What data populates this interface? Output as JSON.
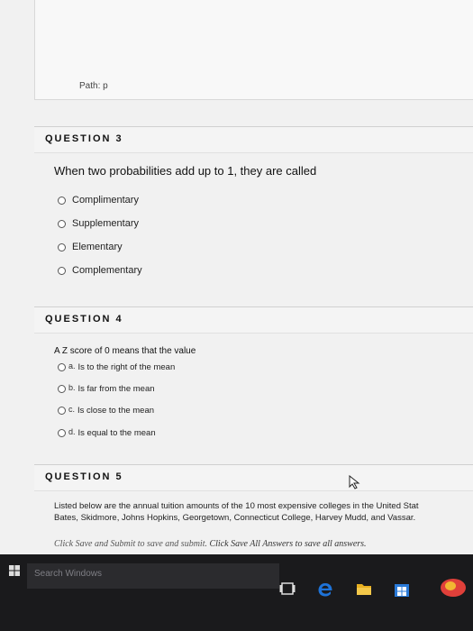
{
  "editor": {
    "path_label": "Path: p"
  },
  "q3": {
    "heading": "QUESTION 3",
    "text": "When two probabilities add up to 1, they are called",
    "options": [
      "Complimentary",
      "Supplementary",
      "Elementary",
      "Complementary"
    ]
  },
  "q4": {
    "heading": "QUESTION 4",
    "text": "A Z score of 0 means that the value",
    "options": [
      {
        "letter": "a.",
        "label": "Is to the right of the mean"
      },
      {
        "letter": "b.",
        "label": "Is far from the mean"
      },
      {
        "letter": "c.",
        "label": "Is close to the mean"
      },
      {
        "letter": "d.",
        "label": "Is equal to the mean"
      }
    ]
  },
  "q5": {
    "heading": "QUESTION 5",
    "line1": "Listed below are the annual tuition amounts of the 10 most expensive colleges in the United Stat",
    "line2": "Bates, Skidmore, Johns Hopkins, Georgetown, Connecticut College, Harvey Mudd, and Vassar."
  },
  "footer": {
    "link1": "Click Save and Submit to save and submit.",
    "link2": "Click Save All Answers to save all answers."
  },
  "taskbar": {
    "search_placeholder": "Search Windows"
  },
  "colors": {
    "taskbar": "#1a1a1c",
    "edge_blue": "#1e73d8",
    "folder_yellow": "#e8b020",
    "store_bg": "#2a7ad8"
  }
}
